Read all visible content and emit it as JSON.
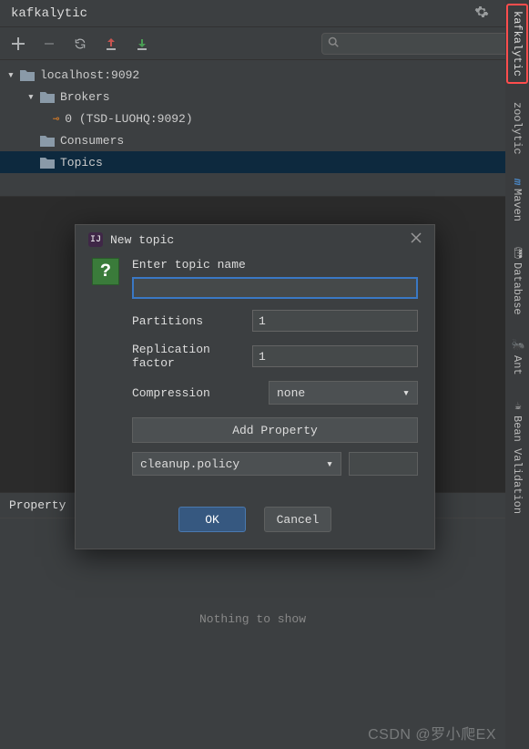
{
  "panel": {
    "title": "kafkalytic"
  },
  "search": {
    "placeholder": ""
  },
  "tree": {
    "root": {
      "label": "localhost:9092"
    },
    "brokers": {
      "label": "Brokers"
    },
    "broker0": {
      "label": "0 (TSD-LUOHQ:9092)"
    },
    "consumers": {
      "label": "Consumers"
    },
    "topics": {
      "label": "Topics"
    }
  },
  "rightTabs": {
    "t0": "kafkalytic",
    "t1": "zoolytic",
    "t2_prefix": "m",
    "t2": "Maven",
    "t3": "Database",
    "t4": "Ant",
    "t5": "Bean Validation"
  },
  "bottom": {
    "col": "Property",
    "empty": "Nothing to show"
  },
  "dialog": {
    "title": "New topic",
    "prompt": "Enter topic name",
    "topic_value": "",
    "partitions_label": "Partitions",
    "partitions_value": "1",
    "replication_label": "Replication factor",
    "replication_value": "1",
    "compression_label": "Compression",
    "compression_value": "none",
    "add_property": "Add Property",
    "policy_value": "cleanup.policy",
    "ok": "OK",
    "cancel": "Cancel"
  },
  "watermark": "CSDN @罗小爬EX"
}
